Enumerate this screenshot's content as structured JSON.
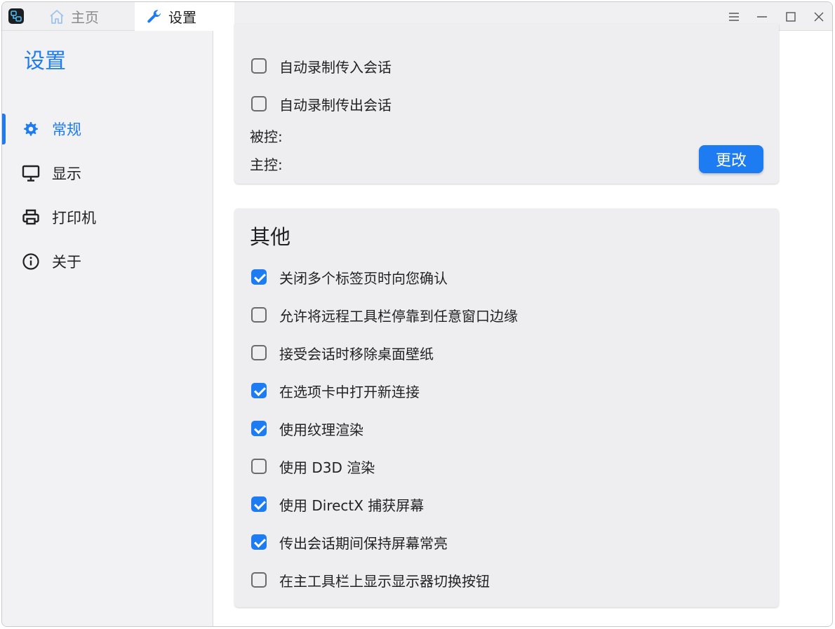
{
  "tabs": [
    {
      "label": "主页",
      "icon": "home-icon",
      "active": false
    },
    {
      "label": "设置",
      "icon": "wrench-icon",
      "active": true
    }
  ],
  "window_controls": [
    "menu-icon",
    "minimize-icon",
    "maximize-icon",
    "close-icon"
  ],
  "sidebar": {
    "title": "设置",
    "items": [
      {
        "label": "常规",
        "icon": "gear-icon",
        "active": true
      },
      {
        "label": "显示",
        "icon": "monitor-icon",
        "active": false
      },
      {
        "label": "打印机",
        "icon": "printer-icon",
        "active": false
      },
      {
        "label": "关于",
        "icon": "info-icon",
        "active": false
      }
    ]
  },
  "recording": {
    "options": [
      {
        "label": "自动录制传入会话",
        "checked": false
      },
      {
        "label": "自动录制传出会话",
        "checked": false
      }
    ],
    "controlled_label": "被控:",
    "controller_label": "主控:",
    "change_button": "更改"
  },
  "other": {
    "title": "其他",
    "options": [
      {
        "label": "关闭多个标签页时向您确认",
        "checked": true
      },
      {
        "label": "允许将远程工具栏停靠到任意窗口边缘",
        "checked": false
      },
      {
        "label": "接受会话时移除桌面壁纸",
        "checked": false
      },
      {
        "label": "在选项卡中打开新连接",
        "checked": true
      },
      {
        "label": "使用纹理渲染",
        "checked": true
      },
      {
        "label": "使用 D3D 渲染",
        "checked": false
      },
      {
        "label": "使用 DirectX 捕获屏幕",
        "checked": true
      },
      {
        "label": "传出会话期间保持屏幕常亮",
        "checked": true
      },
      {
        "label": "在主工具栏上显示显示器切换按钮",
        "checked": false
      }
    ]
  },
  "colors": {
    "accent": "#1e7cf2",
    "sidebar_bg": "#f2f2f4",
    "card_bg": "#eeeef0"
  }
}
